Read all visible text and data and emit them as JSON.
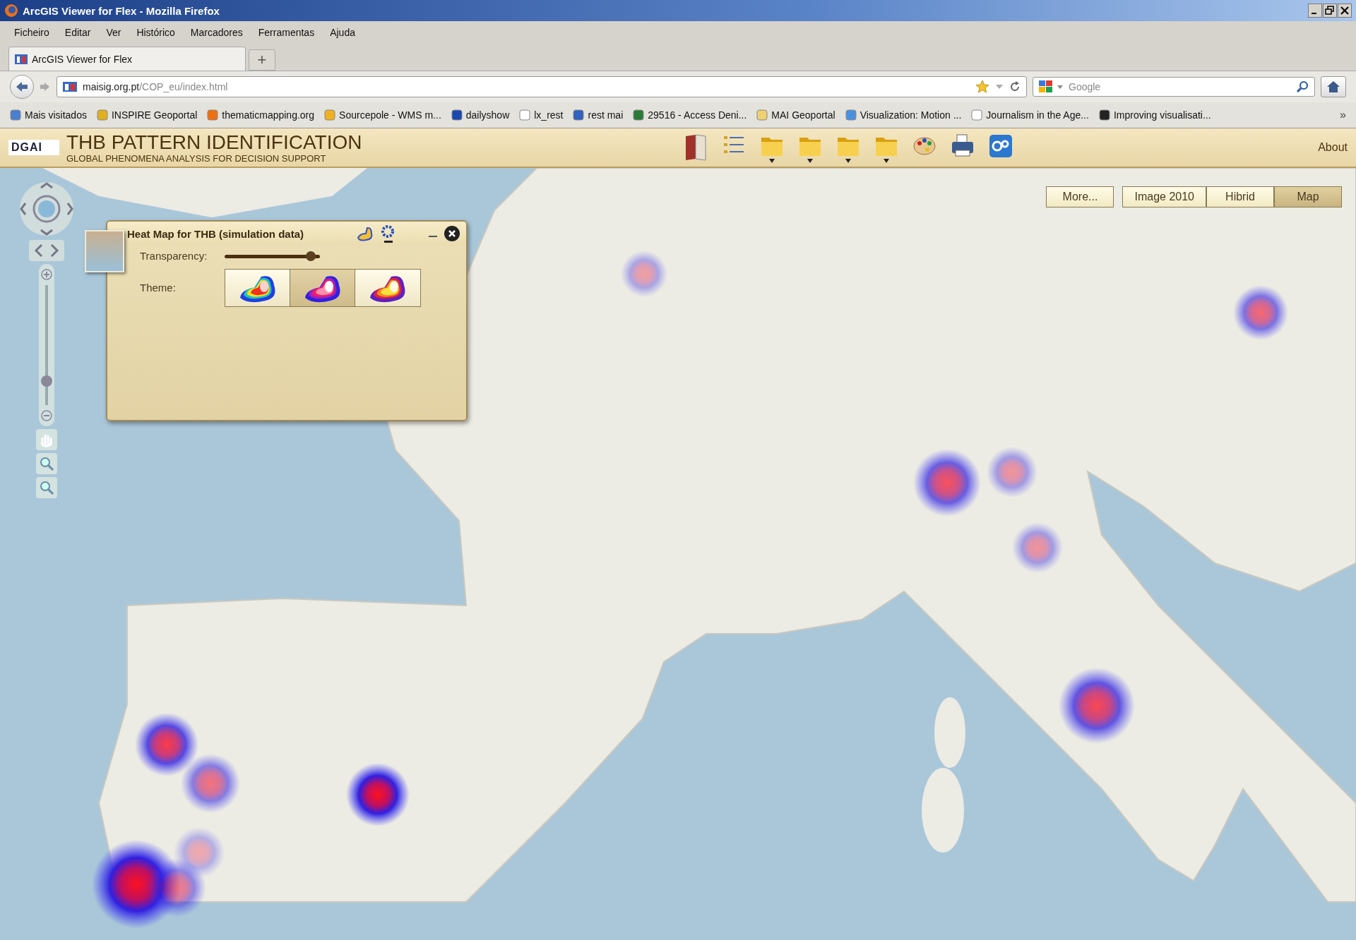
{
  "window": {
    "title": "ArcGIS Viewer for Flex - Mozilla Firefox"
  },
  "menu": [
    "Ficheiro",
    "Editar",
    "Ver",
    "Histórico",
    "Marcadores",
    "Ferramentas",
    "Ajuda"
  ],
  "tabs": [
    {
      "label": "ArcGIS Viewer for Flex",
      "selected": true
    }
  ],
  "new_tab": "+",
  "address": {
    "host": "maisig.org.pt",
    "path": "/COP_eu/index.html"
  },
  "search": {
    "placeholder": "Google"
  },
  "bookmarks": [
    "Mais visitados",
    "INSPIRE Geoportal",
    "thematicmapping.org",
    "Sourcepole - WMS m...",
    "dailyshow",
    "lx_rest",
    "rest mai",
    "29516 - Access Deni...",
    "MAI Geoportal",
    "Visualization: Motion ...",
    "Journalism in the Age...",
    "Improving visualisati..."
  ],
  "bookmarks_overflow": "»",
  "app": {
    "logo": "DGAI",
    "title": "THB PATTERN IDENTIFICATION",
    "subtitle": "GLOBAL PHENOMENA ANALYSIS FOR DECISION SUPPORT",
    "about": "About"
  },
  "map": {
    "zoom": {
      "level": 0.2
    },
    "basemaps": [
      {
        "label": "More...",
        "selected": false
      },
      {
        "label": "Image 2010",
        "selected": false
      },
      {
        "label": "Hibrid",
        "selected": false
      },
      {
        "label": "Map",
        "selected": true
      }
    ]
  },
  "heat_panel": {
    "title": "Heat Map for THB (simulation data)",
    "transparency_label": "Transparency:",
    "transparency": {
      "level": 0.9
    },
    "theme_label": "Theme:",
    "themes": [
      {
        "selected": false
      },
      {
        "selected": true
      },
      {
        "selected": false
      }
    ]
  }
}
